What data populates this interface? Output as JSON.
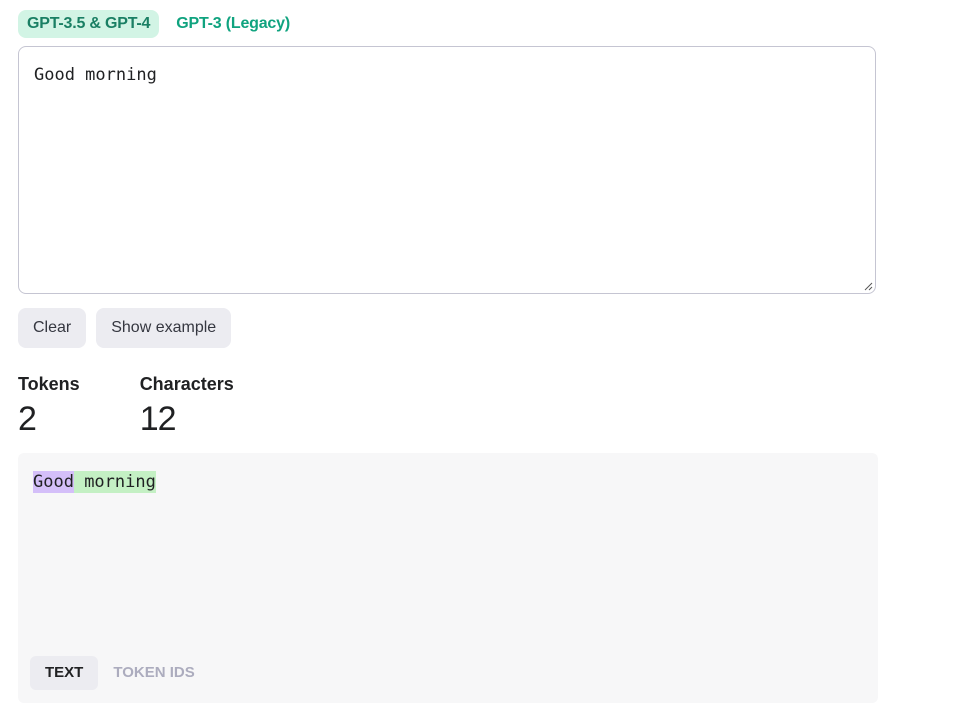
{
  "model_tabs": [
    {
      "label": "GPT-3.5 & GPT-4",
      "active": true
    },
    {
      "label": "GPT-3 (Legacy)",
      "active": false
    }
  ],
  "input": {
    "value": "Good morning"
  },
  "buttons": {
    "clear_label": "Clear",
    "example_label": "Show example"
  },
  "stats": {
    "tokens_label": "Tokens",
    "tokens_value": "2",
    "characters_label": "Characters",
    "characters_value": "12"
  },
  "output": {
    "tokens": [
      {
        "text": "Good",
        "color": "#d4bff9"
      },
      {
        "text": " morning",
        "color": "#c4f0c4"
      }
    ]
  },
  "view_tabs": [
    {
      "label": "TEXT",
      "active": true
    },
    {
      "label": "TOKEN IDS",
      "active": false
    }
  ],
  "colors": {
    "accent": "#10a37f",
    "accent_bg": "#d2f4e5"
  }
}
